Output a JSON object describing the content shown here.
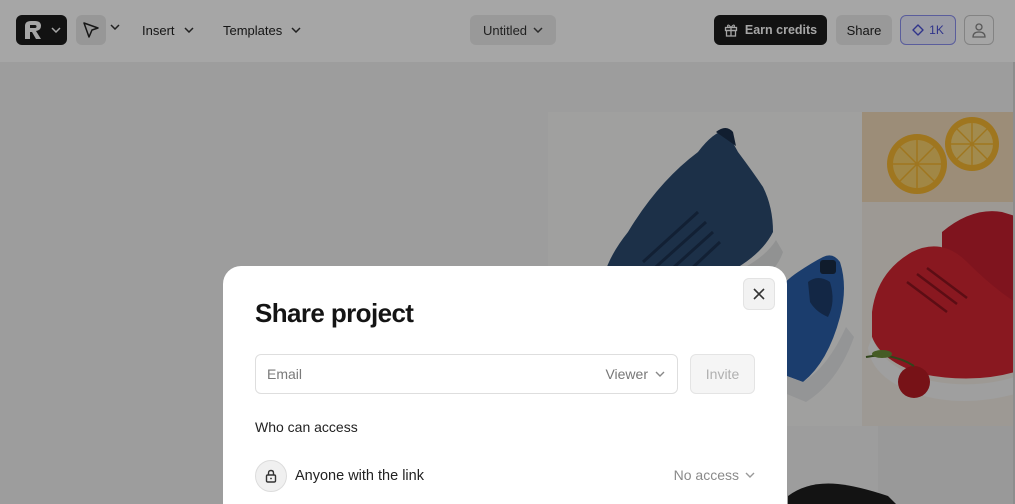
{
  "toolbar": {
    "insert_label": "Insert",
    "templates_label": "Templates",
    "project_title": "Untitled",
    "earn_credits_label": "Earn credits",
    "share_label": "Share",
    "credits_count": "1K"
  },
  "modal": {
    "title": "Share project",
    "email_placeholder": "Email",
    "role_value": "Viewer",
    "invite_label": "Invite",
    "section_label": "Who can access",
    "link_access_label": "Anyone with the link",
    "link_access_value": "No access"
  },
  "icons": {
    "logo": "logo-icon",
    "select_tool": "cursor-arrow-icon",
    "gift": "gift-icon",
    "credits": "sparkle-icon",
    "user": "user-icon",
    "close": "close-icon",
    "lock": "lock-icon",
    "chevron": "chevron-down-icon"
  },
  "colors": {
    "dark_button": "#1c1c1c",
    "credits_accent": "#4b51d6",
    "overlay": "rgba(0,0,0,0.35)"
  }
}
